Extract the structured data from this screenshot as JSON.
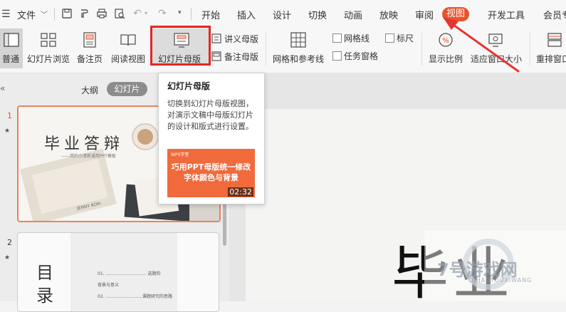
{
  "menubar": {
    "file_label": "文件",
    "tabs": [
      "开始",
      "插入",
      "设计",
      "切换",
      "动画",
      "放映",
      "审阅",
      "视图",
      "开发工具",
      "会员专"
    ]
  },
  "ribbon": {
    "normal": "普通",
    "slide_browse": "幻灯片浏览",
    "notes_page": "备注页",
    "reading_view": "阅读视图",
    "slide_master": "幻灯片母版",
    "handout_master": "讲义母版",
    "notes_master": "备注母版",
    "grid_guides": "网格和参考线",
    "gridlines": "网格线",
    "ruler": "标尺",
    "task_pane": "任务窗格",
    "zoom": "显示比例",
    "fit_window": "适应窗口大小",
    "rearrange": "重排窗口"
  },
  "panel": {
    "outline_tab": "大纲",
    "slides_tab": "幻灯片",
    "slide1_num": "1",
    "slide2_num": "2",
    "slide1_title": "毕业答辩",
    "slide1_subtitle": "——简约小清新通用PPT模板",
    "slide1_footer": "JENNY KOPI",
    "slide2_title": "目录",
    "slide2_items": [
      "01.  ..............................  选题的",
      "背景与意义",
      "02.  ...........................课题研究的思路"
    ]
  },
  "tooltip": {
    "title": "幻灯片母版",
    "description": "切换到幻灯片母版视图，对演示文稿中母版幻灯片的设计和版式进行设置。",
    "video_brand": "WPS学堂",
    "video_title": "巧用PPT母版统一修改字体颜色与背景",
    "video_duration": "02:32"
  },
  "canvas": {
    "partial_title": "毕业"
  },
  "watermark": {
    "text": "7号游戏网",
    "sub": "QIHAOYOUXIWANG"
  },
  "colors": {
    "accent": "#e8542d",
    "highlight_box": "#e62525",
    "arrow": "#e63333"
  }
}
